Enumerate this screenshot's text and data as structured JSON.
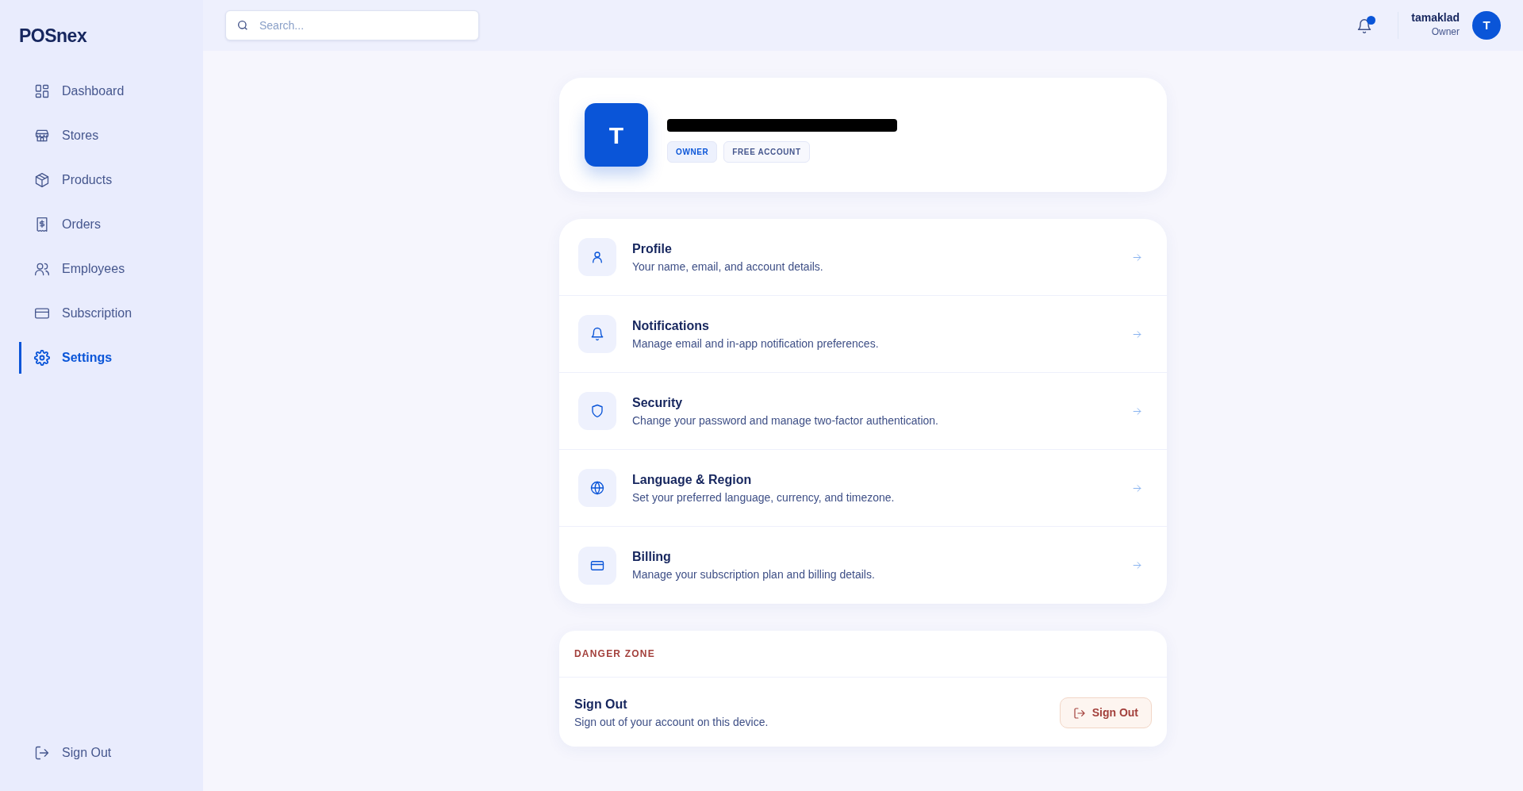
{
  "sidebar": {
    "logo": "POSnex",
    "items": [
      {
        "label": "Dashboard",
        "kind": "grid",
        "selected": false
      },
      {
        "label": "Stores",
        "kind": "store",
        "selected": false
      },
      {
        "label": "Products",
        "kind": "box",
        "selected": false
      },
      {
        "label": "Orders",
        "kind": "receipt",
        "selected": false
      },
      {
        "label": "Employees",
        "kind": "users",
        "selected": false
      },
      {
        "label": "Subscription",
        "kind": "card",
        "selected": false
      },
      {
        "label": "Settings",
        "kind": "gear",
        "selected": true
      }
    ],
    "footer": {
      "label": "Sign Out",
      "kind": "logout"
    }
  },
  "topbar": {
    "search": {
      "placeholder": "Search..."
    },
    "notifications": {
      "unread": true
    },
    "user": {
      "name": "tamaklad",
      "role": "Owner",
      "initial": "T"
    }
  },
  "account": {
    "initial": "T",
    "email_redacted": true,
    "badges": [
      {
        "label": "OWNER",
        "kind": "primary"
      },
      {
        "label": "FREE ACCOUNT",
        "kind": "plain"
      }
    ]
  },
  "settings": [
    {
      "title": "Profile",
      "description": "Your name, email, and account details.",
      "kind": "user"
    },
    {
      "title": "Notifications",
      "description": "Manage email and in-app notification preferences.",
      "kind": "bell"
    },
    {
      "title": "Security",
      "description": "Change your password and manage two-factor authentication.",
      "kind": "shield"
    },
    {
      "title": "Language & Region",
      "description": "Set your preferred language, currency, and timezone.",
      "kind": "globe"
    },
    {
      "title": "Billing",
      "description": "Manage your subscription plan and billing details.",
      "kind": "card"
    }
  ],
  "danger_zone": {
    "heading": "DANGER ZONE",
    "title": "Sign Out",
    "description": "Sign out of your account on this device.",
    "button": "Sign Out"
  }
}
